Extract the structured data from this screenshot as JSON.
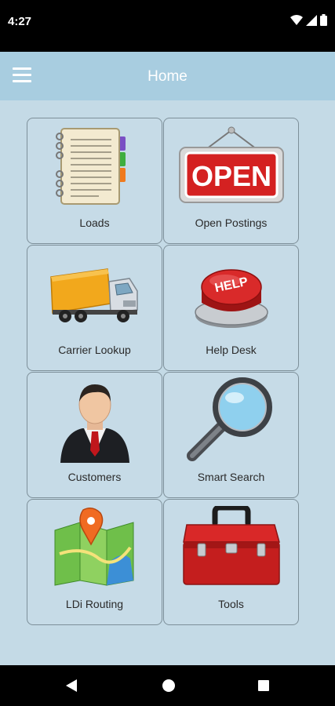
{
  "status_bar": {
    "time": "4:27"
  },
  "app_bar": {
    "title": "Home"
  },
  "tiles": [
    {
      "label": "Loads",
      "icon": "notebook-icon"
    },
    {
      "label": "Open Postings",
      "icon": "open-sign-icon"
    },
    {
      "label": "Carrier Lookup",
      "icon": "truck-icon"
    },
    {
      "label": "Help Desk",
      "icon": "help-button-icon"
    },
    {
      "label": "Customers",
      "icon": "businessman-icon"
    },
    {
      "label": "Smart Search",
      "icon": "magnifier-icon"
    },
    {
      "label": "LDi Routing",
      "icon": "map-pin-icon"
    },
    {
      "label": "Tools",
      "icon": "toolbox-icon"
    }
  ],
  "signs": {
    "open": "OPEN",
    "help": "HELP"
  },
  "colors": {
    "app_bar": "#a8cde0",
    "background": "#c4dae6",
    "tile_border": "#7d8f99"
  }
}
